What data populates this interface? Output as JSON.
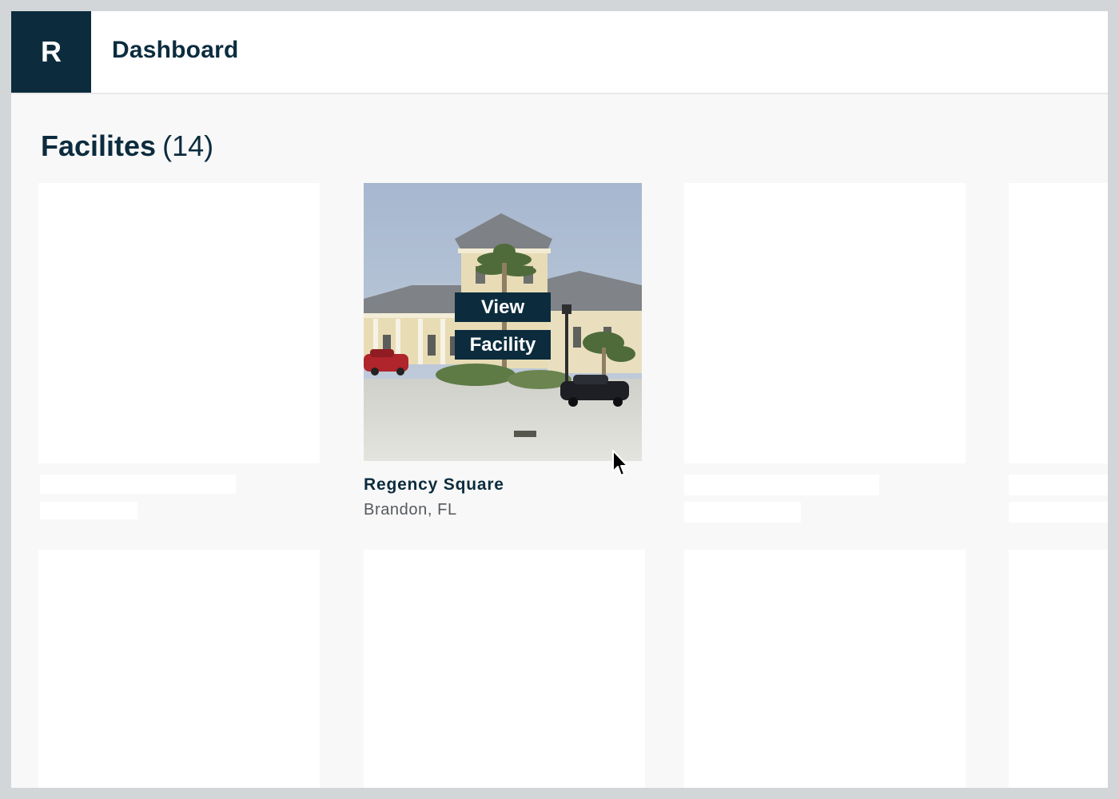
{
  "app": {
    "logo_letter": "R",
    "title": "Dashboard",
    "brand_color": "#0c2c3e"
  },
  "section": {
    "title": "Facilites",
    "count": "(14)"
  },
  "facility": {
    "name": "Regency Square",
    "location": "Brandon, FL",
    "overlay_button": {
      "line1": "View",
      "line2": "Facility"
    },
    "photo_icon": "building-photo"
  },
  "placeholders": {
    "state": "loading",
    "tile_color": "#ffffff"
  },
  "cursor": {
    "icon": "mouse-pointer-icon"
  }
}
